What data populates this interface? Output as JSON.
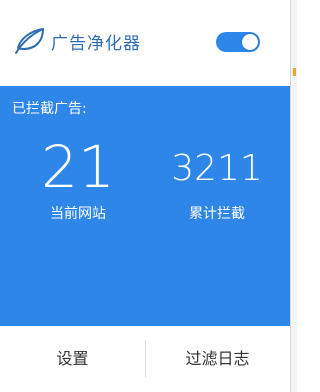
{
  "app": {
    "title": "广告净化器",
    "logo_icon": "leaf-icon",
    "enabled": true,
    "accent_color": "#2e86e8"
  },
  "stats": {
    "blocked_label": "已拦截广告:",
    "current_site_count": "21",
    "current_site_label": "当前网站",
    "total_count": "3211",
    "total_label": "累计拦截"
  },
  "footer": {
    "settings_label": "设置",
    "filter_log_label": "过滤日志"
  }
}
